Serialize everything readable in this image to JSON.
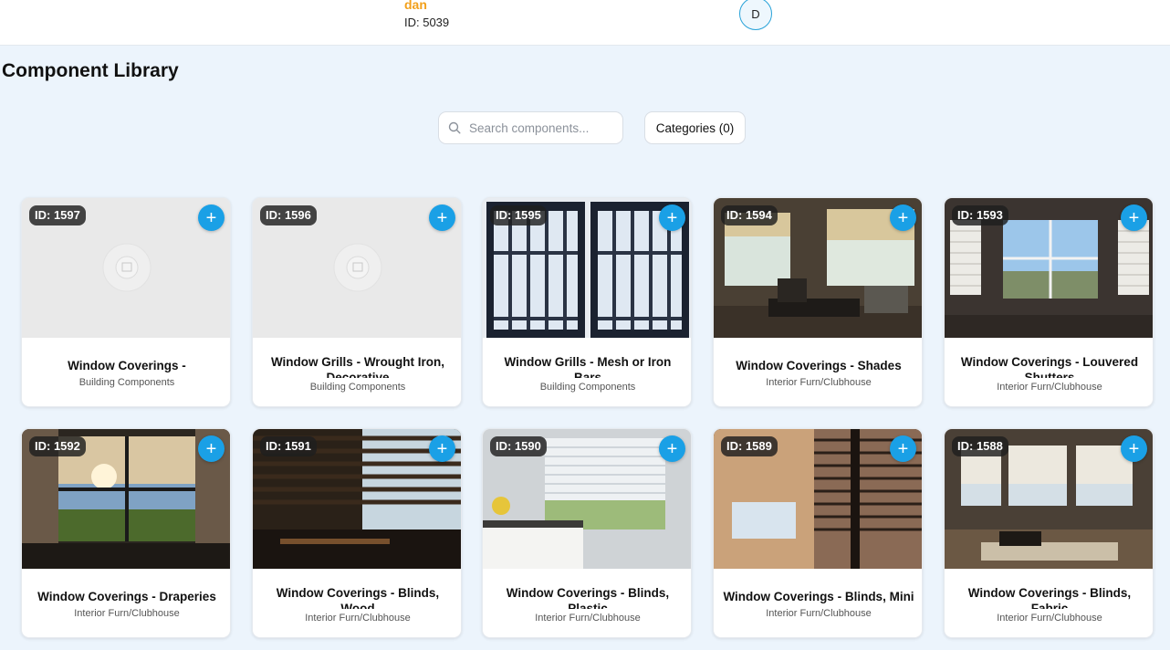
{
  "user": {
    "name": "dan",
    "id_label": "ID: 5039",
    "avatar_initial": "D"
  },
  "page": {
    "title": "Component Library"
  },
  "search": {
    "placeholder": "Search components...",
    "icon": "search-icon"
  },
  "categories_button": {
    "label": "Categories (0)"
  },
  "colors": {
    "accent": "#1aa0e6",
    "user_name": "#f2a01b",
    "background": "#ecf4fc"
  },
  "cards": [
    {
      "id_label": "ID: 1597",
      "title": "Window Coverings -",
      "category": "Building Components",
      "image": "placeholder"
    },
    {
      "id_label": "ID: 1596",
      "title": "Window Grills - Wrought Iron, Decorative",
      "category": "Building Components",
      "image": "placeholder"
    },
    {
      "id_label": "ID: 1595",
      "title": "Window Grills - Mesh or Iron Bars",
      "category": "Building Components",
      "image": "grills"
    },
    {
      "id_label": "ID: 1594",
      "title": "Window Coverings - Shades",
      "category": "Interior Furn/Clubhouse",
      "image": "shades"
    },
    {
      "id_label": "ID: 1593",
      "title": "Window Coverings - Louvered Shutters",
      "category": "Interior Furn/Clubhouse",
      "image": "shutters"
    },
    {
      "id_label": "ID: 1592",
      "title": "Window Coverings - Draperies",
      "category": "Interior Furn/Clubhouse",
      "image": "draperies"
    },
    {
      "id_label": "ID: 1591",
      "title": "Window Coverings - Blinds, Wood",
      "category": "Interior Furn/Clubhouse",
      "image": "wood-blinds"
    },
    {
      "id_label": "ID: 1590",
      "title": "Window Coverings - Blinds, Plastic",
      "category": "Interior Furn/Clubhouse",
      "image": "plastic-blinds"
    },
    {
      "id_label": "ID: 1589",
      "title": "Window Coverings - Blinds, Mini",
      "category": "Interior Furn/Clubhouse",
      "image": "mini-blinds"
    },
    {
      "id_label": "ID: 1588",
      "title": "Window Coverings - Blinds, Fabric",
      "category": "Interior Furn/Clubhouse",
      "image": "fabric-blinds"
    }
  ]
}
